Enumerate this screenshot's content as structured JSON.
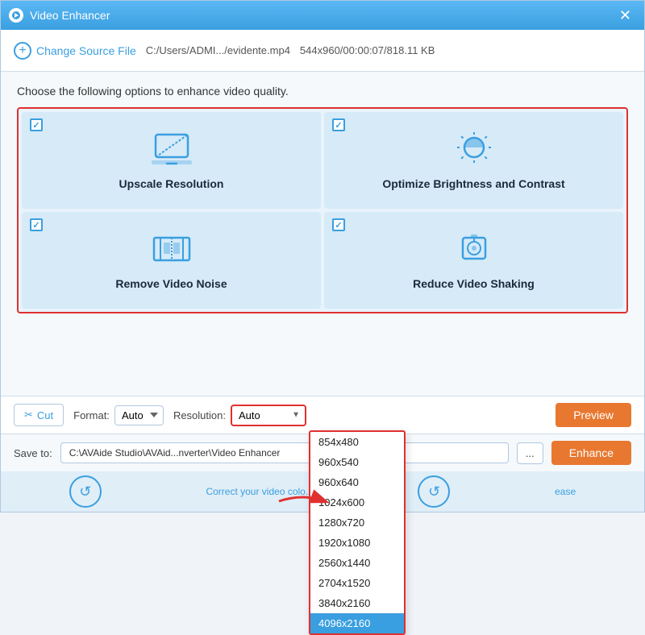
{
  "window": {
    "title": "Video Enhancer",
    "close_label": "✕"
  },
  "source_bar": {
    "add_label": "Change Source File",
    "file_path": "C:/Users/ADMI.../evidente.mp4",
    "file_info": "544x960/00:00:07/818.11 KB"
  },
  "instruction": "Choose the following options to enhance video quality.",
  "options": [
    {
      "id": "upscale",
      "label": "Upscale Resolution",
      "checked": true
    },
    {
      "id": "brightness",
      "label": "Optimize Brightness and Contrast",
      "checked": true
    },
    {
      "id": "noise",
      "label": "Remove Video Noise",
      "checked": true
    },
    {
      "id": "shaking",
      "label": "Reduce Video Shaking",
      "checked": true
    }
  ],
  "toolbar": {
    "cut_label": "Cut",
    "format_label": "Format:",
    "format_value": "Auto",
    "resolution_label": "Resolution:",
    "resolution_value": "Auto",
    "preview_label": "Preview"
  },
  "resolution_dropdown": {
    "items": [
      "854x480",
      "960x540",
      "960x640",
      "1024x600",
      "1280x720",
      "1920x1080",
      "2560x1440",
      "2704x1520",
      "3840x2160",
      "4096x2160"
    ],
    "selected": "4096x2160"
  },
  "save_bar": {
    "save_label": "Save to:",
    "save_path": "C:\\AVAide Studio\\AVAid...nverter\\Video Enhancer",
    "dots_label": "...",
    "enhance_label": "Enhance"
  },
  "bottom_preview": {
    "text1": "Correct your video colo...",
    "text2": "ease"
  },
  "icons": {
    "plus": "+",
    "scissors": "✂",
    "arrow_down": "▼"
  }
}
